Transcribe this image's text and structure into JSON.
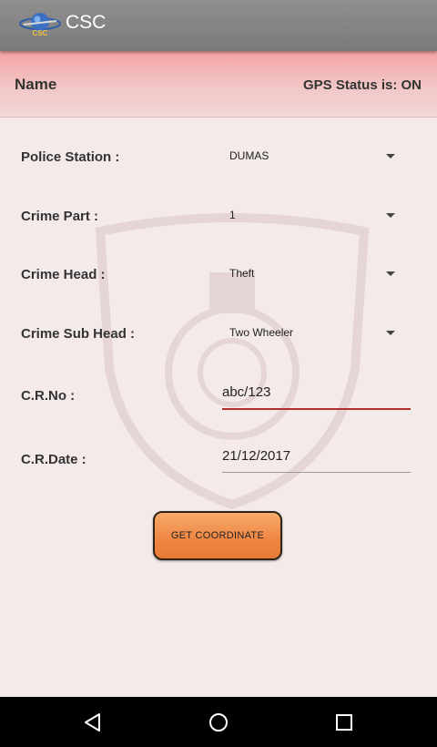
{
  "app": {
    "title": "CSC",
    "logo_text": "CSC"
  },
  "header": {
    "name_label": "Name",
    "gps_status": "GPS Status is: ON"
  },
  "form": {
    "police_station": {
      "label": "Police Station :",
      "value": "DUMAS"
    },
    "crime_part": {
      "label": "Crime Part :",
      "value": "1"
    },
    "crime_head": {
      "label": "Crime Head :",
      "value": "Theft"
    },
    "crime_sub_head": {
      "label": "Crime Sub Head :",
      "value": "Two Wheeler"
    },
    "cr_no": {
      "label": "C.R.No :",
      "value": "abc/123"
    },
    "cr_date": {
      "label": "C.R.Date :",
      "value": "21/12/2017"
    }
  },
  "actions": {
    "get_coordinate": "GET COORDINATE"
  },
  "icons": {
    "navbar": [
      "back-icon",
      "home-icon",
      "recents-icon"
    ],
    "dropdown": "chevron-down-icon",
    "logo": "csc-logo-icon",
    "watermark": "police-emblem-watermark"
  },
  "colors": {
    "appbar": "#858585",
    "header_top": "#f6a3a3",
    "content_bg": "#f4eaea",
    "button": "#ef8542",
    "active_underline": "#b03030",
    "navbar": "#000000"
  }
}
